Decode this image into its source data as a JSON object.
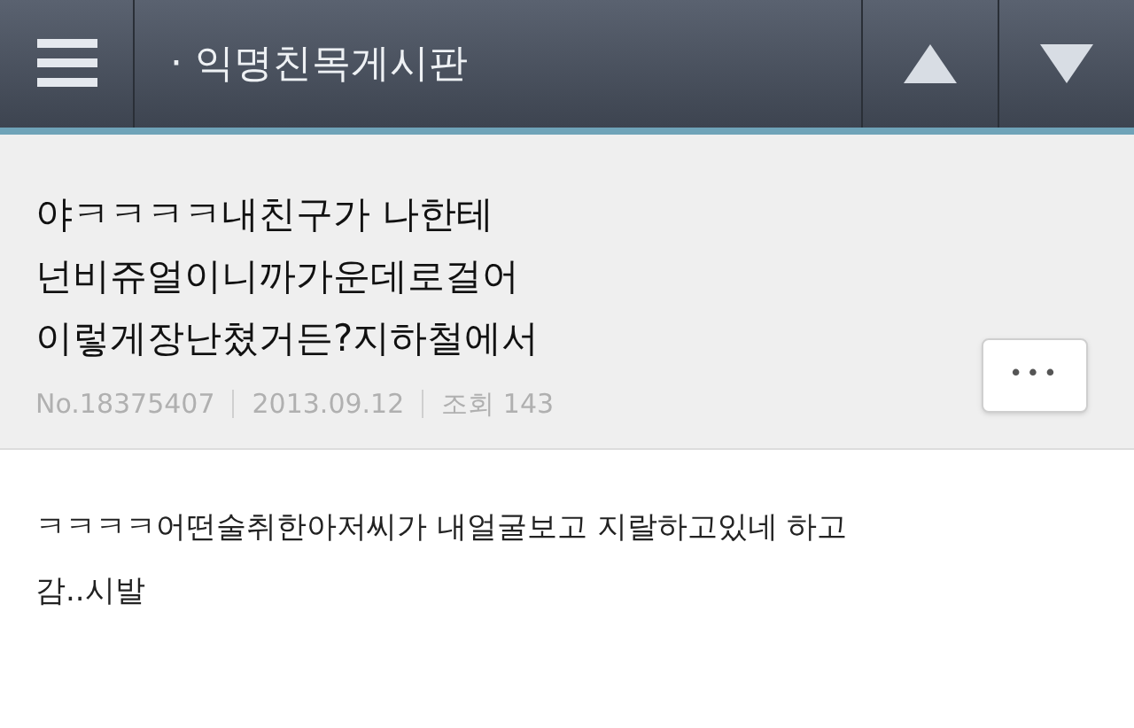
{
  "header": {
    "title": "· 익명친목게시판"
  },
  "post": {
    "title_lines": [
      "야ㅋㅋㅋㅋ내친구가 나한테",
      "넌비쥬얼이니까가운데로걸어",
      "이렇게장난쳤거든?지하철에서"
    ],
    "meta": [
      "No.18375407",
      "2013.09.12",
      "조회 143"
    ],
    "more_button": "•••",
    "body": "ㅋㅋㅋㅋ어떤술취한아저씨가 내얼굴보고 지랄하고있네 하고\n감..시발"
  }
}
